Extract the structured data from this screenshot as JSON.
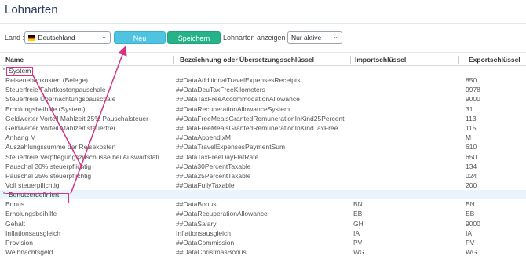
{
  "page": {
    "title": "Lohnarten"
  },
  "toolbar": {
    "country_label": "Land :",
    "country_value": "Deutschland",
    "new_label": "Neu",
    "save_label": "Speichern",
    "filter_label": "Lohnarten anzeigen :",
    "filter_value": "Nur aktive"
  },
  "table": {
    "columns": [
      "Name",
      "Bezeichnung oder Übersetzungsschlüssel",
      "Importschlüssel",
      "Exportschlüssel"
    ],
    "groups": [
      {
        "name": "System",
        "rows": [
          [
            "Reisenebenkosten (Belege)",
            "##DataAdditionalTravelExpensesReceipts",
            "",
            "850"
          ],
          [
            "Steuerfreie Fahrtkostenpauschale",
            "##DataDeuTaxFreeKilometers",
            "",
            "9978"
          ],
          [
            "Steuerfreie Übernachtungspauschale",
            "##DataTaxFreeAccommodationAllowance",
            "",
            "9000"
          ],
          [
            "Erholungsbeihilfe (System)",
            "##DataRecuperationAllowanceSystem",
            "",
            "31"
          ],
          [
            "Geldwerter Vorteil Mahlzeit 25% Pauschalsteuer",
            "##DataFreeMealsGrantedRemunerationInKind25Percent",
            "",
            "113"
          ],
          [
            "Geldwerter Vorteil Mahlzeit steuerfrei",
            "##DataFreeMealsGrantedRemunerationInKindTaxFree",
            "",
            "115"
          ],
          [
            "Anhang M",
            "##DataAppendixM",
            "",
            "M"
          ],
          [
            "Auszahlungssumme der Reisekosten",
            "##DataTravelExpensesPaymentSum",
            "",
            "610"
          ],
          [
            "Steuerfreie Verpflegungszuschüsse bei Auswärtstäti...",
            "##DataTaxFreeDayFlatRate",
            "",
            "650"
          ],
          [
            "Pauschal 30% steuerpflichtig",
            "##Data30PercentTaxable",
            "",
            "134"
          ],
          [
            "Pauschal 25% steuerpflichtig",
            "##Data25PercentTaxable",
            "",
            "024"
          ],
          [
            "Voll steuerpflichtig",
            "##DataFullyTaxable",
            "",
            "200"
          ]
        ]
      },
      {
        "name": "Benutzerdefiniert",
        "rows": [
          [
            "Bonus",
            "##DataBonus",
            "BN",
            "BN"
          ],
          [
            "Erholungsbeihilfe",
            "##DataRecuperationAllowance",
            "EB",
            "EB"
          ],
          [
            "Gehalt",
            "##DataSalary",
            "GH",
            "9000"
          ],
          [
            "Inflationsausgleich",
            "Inflationsausgleich",
            "IA",
            "IA"
          ],
          [
            "Provision",
            "##DataCommission",
            "PV",
            "PV"
          ],
          [
            "Weihnachtsgeld",
            "##DataChristmasBonus",
            "WG",
            "WG"
          ]
        ]
      }
    ]
  },
  "colors": {
    "accent_new": "#4fc3e0",
    "accent_save": "#27b38a",
    "highlight": "#d63384",
    "group_selected_bg": "#e9f4fc"
  },
  "icons": {
    "country_flag": "flag-germany-icon",
    "dropdown": "chevron-down-icon",
    "group_toggle": "caret-down-icon"
  }
}
